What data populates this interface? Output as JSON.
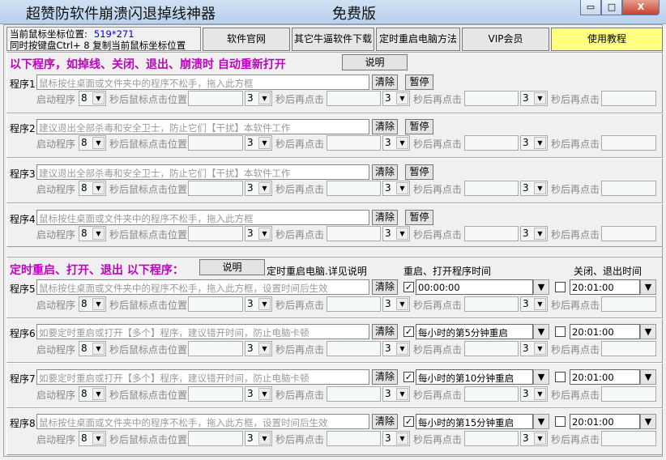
{
  "window": {
    "title": "超赞防软件崩溃闪退掉线神器",
    "edition": "免费版",
    "minimize": "▭",
    "maximize": "□",
    "close": "X"
  },
  "info": {
    "coord_label": "当前鼠标坐标位置:",
    "coord_value": "519*271",
    "hint": "同时按键盘Ctrl+ 8 复制当前鼠标坐标位置"
  },
  "toolbar": [
    {
      "label": "软件官网",
      "color": "#e6e6e6"
    },
    {
      "label": "其它牛逼软件下载",
      "color": "#e6e6e6"
    },
    {
      "label": "定时重启电脑方法",
      "color": "#e6e6e6"
    },
    {
      "label": "VIP会员",
      "color": "#e6e6e6"
    },
    {
      "label": "使用教程",
      "color": "#ffff80"
    }
  ],
  "section1": {
    "heading": "以下程序，如掉线、关闭、退出、崩溃时  自动重新打开",
    "explain": "说明"
  },
  "section2": {
    "heading": "定时重启、打开、退出  以下程序：",
    "explain": "说明",
    "note": "定时重启电脑.详见说明",
    "col_restart": "重启、打开程序时间",
    "col_close": "关闭、退出时间"
  },
  "labels": {
    "clear": "清除",
    "pause": "暂停",
    "start": "启动程序",
    "after_click_pos": "秒后鼠标点击位置",
    "after_click_again": "秒后再点击"
  },
  "programs": [
    {
      "label": "程序1",
      "placeholder": "鼠标按住桌面或文件夹中的程序不松手，拖入此方框",
      "delay": "8",
      "d2": "3",
      "d3": "3",
      "d4": "3"
    },
    {
      "label": "程序2",
      "placeholder": "建议退出全部杀毒和安全卫士，防止它们【干扰】本软件工作",
      "delay": "8",
      "d2": "3",
      "d3": "3",
      "d4": "3"
    },
    {
      "label": "程序3",
      "placeholder": "建议退出全部杀毒和安全卫士，防止它们【干扰】本软件工作",
      "delay": "8",
      "d2": "3",
      "d3": "3",
      "d4": "3"
    },
    {
      "label": "程序4",
      "placeholder": "鼠标按住桌面或文件夹中的程序不松手，拖入此方框",
      "delay": "8",
      "d2": "3",
      "d3": "3",
      "d4": "3"
    }
  ],
  "scheduled": [
    {
      "label": "程序5",
      "placeholder": "鼠标按住桌面或文件夹中的程序不松手，拖入此方框，设置时间后生效",
      "restart_checked": true,
      "restart_time": "00:00:00",
      "close_checked": false,
      "close_time": "20:01:00",
      "delay": "8",
      "d2": "3",
      "d3": "3",
      "d4": "3"
    },
    {
      "label": "程序6",
      "placeholder": "如要定时重启或打开【多个】程序，建议错开时间，防止电脑卡顿",
      "restart_checked": true,
      "restart_time": "每小时的第5分钟重启",
      "close_checked": false,
      "close_time": "20:01:00",
      "delay": "8",
      "d2": "3",
      "d3": "3",
      "d4": "3"
    },
    {
      "label": "程序7",
      "placeholder": "如要定时重启或打开【多个】程序，建议错开时间，防止电脑卡顿",
      "restart_checked": true,
      "restart_time": "每小时的第10分钟重启",
      "close_checked": false,
      "close_time": "20:01:00",
      "delay": "8",
      "d2": "3",
      "d3": "3",
      "d4": "3"
    },
    {
      "label": "程序8",
      "placeholder": "鼠标按住桌面或文件夹中的程序不松手，拖入此方框，设置时间后生效",
      "restart_checked": true,
      "restart_time": "每小时的第15分钟重启",
      "close_checked": false,
      "close_time": "20:01:00",
      "delay": "8",
      "d2": "3",
      "d3": "3",
      "d4": "3"
    }
  ]
}
